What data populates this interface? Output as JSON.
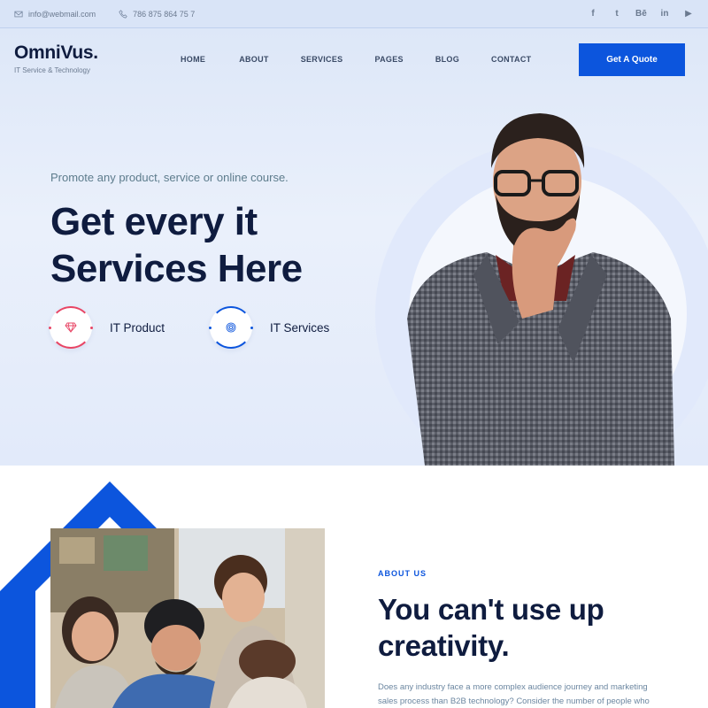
{
  "topbar": {
    "email": "info@webmail.com",
    "phone": "786 875 864 75 7",
    "socials": [
      "f",
      "t",
      "Bē",
      "in",
      "▶"
    ]
  },
  "header": {
    "logo": "OmniVus.",
    "tagline": "IT Service & Technology",
    "nav": [
      "HOME",
      "ABOUT",
      "SERVICES",
      "PAGES",
      "BLOG",
      "CONTACT"
    ],
    "cta": "Get A Quote"
  },
  "hero": {
    "subhead": "Promote any product, service or online course.",
    "headline_line1": "Get every it",
    "headline_line2": "Services Here",
    "features": [
      {
        "label": "IT Product",
        "icon": "diamond-icon",
        "color": "#e84565"
      },
      {
        "label": "IT Services",
        "icon": "fingerprint-icon",
        "color": "#0c55dd"
      }
    ]
  },
  "about": {
    "eyebrow": "ABOUT US",
    "title_line1": "You can't use up",
    "title_line2": "creativity.",
    "text": "Does any industry face a more complex audience journey and marketing sales process than B2B technology? Consider the number of people who"
  },
  "colors": {
    "accent": "#0c55dd",
    "dark": "#0f1c3f",
    "red": "#e84565"
  }
}
